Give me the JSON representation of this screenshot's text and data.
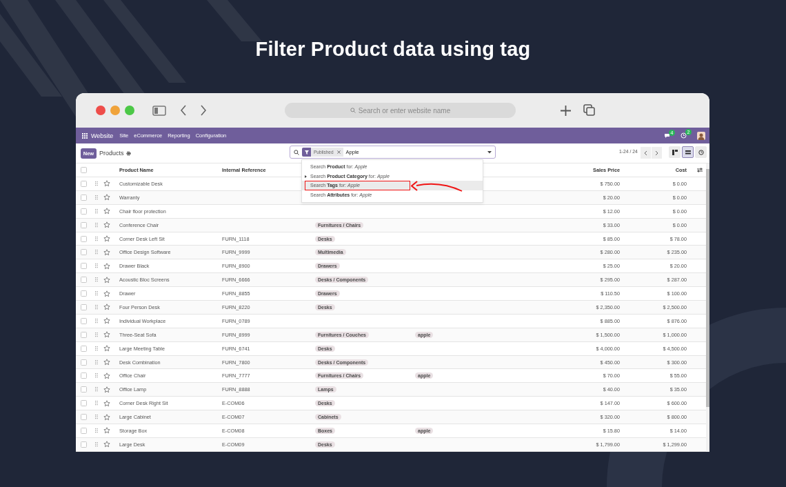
{
  "page_title": "Filter Product data using tag",
  "browser": {
    "address_placeholder": "Search or enter website name"
  },
  "navbar": {
    "app": "Website",
    "menu": [
      "Site",
      "eCommerce",
      "Reporting",
      "Configuration"
    ],
    "badges": [
      "4",
      "2"
    ]
  },
  "control_panel": {
    "new_button": "New",
    "breadcrumb": "Products",
    "search": {
      "facet": "Published",
      "query": "Apple"
    },
    "pager": "1-24 / 24",
    "views": [
      {
        "kind": "kanban",
        "selected": false
      },
      {
        "kind": "list",
        "selected": true
      },
      {
        "kind": "activity",
        "selected": false
      }
    ]
  },
  "suggestions": [
    {
      "text": "Search **Product** for: *Apple*",
      "expandable": false,
      "highlighted": false
    },
    {
      "text": "Search **Product Category** for: *Apple*",
      "expandable": true,
      "highlighted": false
    },
    {
      "text": "Search **Tags** for: *Apple*",
      "expandable": false,
      "highlighted": true
    },
    {
      "text": "Search **Attributes** for: *Apple*",
      "expandable": false,
      "highlighted": false
    }
  ],
  "table": {
    "all_checked": false,
    "columns": [
      "Product Name",
      "Internal Reference",
      "Sales Price",
      "Cost"
    ],
    "rows": [
      {
        "name": "Customizable Desk",
        "price": "$ 750.00",
        "cost": "$ 0.00",
        "checked": false,
        "favorite": false
      },
      {
        "name": "Warranty",
        "price": "$ 20.00",
        "cost": "$ 0.00",
        "checked": false,
        "favorite": false
      },
      {
        "name": "Chair floor protection",
        "price": "$ 12.00",
        "cost": "$ 0.00",
        "checked": false,
        "favorite": false
      },
      {
        "name": "Conference Chair",
        "category": "Furnitures / Chairs",
        "price": "$ 33.00",
        "cost": "$ 0.00",
        "checked": false,
        "favorite": false
      },
      {
        "name": "Corner Desk Left Sit",
        "reference": "FURN_1118",
        "category": "Desks",
        "price": "$ 85.00",
        "cost": "$ 78.00",
        "checked": false,
        "favorite": false
      },
      {
        "name": "Office Design Software",
        "reference": "FURN_9999",
        "category": "Multimedia",
        "price": "$ 280.00",
        "cost": "$ 235.00",
        "checked": false,
        "favorite": false
      },
      {
        "name": "Drawer Black",
        "reference": "FURN_8900",
        "category": "Drawers",
        "price": "$ 25.00",
        "cost": "$ 20.00",
        "checked": false,
        "favorite": false
      },
      {
        "name": "Acoustic Bloc Screens",
        "reference": "FURN_6666",
        "category": "Desks / Components",
        "price": "$ 295.00",
        "cost": "$ 287.00",
        "checked": false,
        "favorite": false
      },
      {
        "name": "Drawer",
        "reference": "FURN_8855",
        "category": "Drawers",
        "price": "$ 110.50",
        "cost": "$ 100.00",
        "checked": false,
        "favorite": false
      },
      {
        "name": "Four Person Desk",
        "reference": "FURN_8220",
        "category": "Desks",
        "price": "$ 2,350.00",
        "cost": "$ 2,500.00",
        "checked": false,
        "favorite": false
      },
      {
        "name": "Individual Workplace",
        "reference": "FURN_0789",
        "price": "$ 885.00",
        "cost": "$ 876.00",
        "checked": false,
        "favorite": false
      },
      {
        "name": "Three-Seat Sofa",
        "reference": "FURN_8999",
        "category": "Furnitures / Couches",
        "tag": "apple",
        "price": "$ 1,500.00",
        "cost": "$ 1,000.00",
        "checked": false,
        "favorite": false
      },
      {
        "name": "Large Meeting Table",
        "reference": "FURN_6741",
        "category": "Desks",
        "price": "$ 4,000.00",
        "cost": "$ 4,500.00",
        "checked": false,
        "favorite": false
      },
      {
        "name": "Desk Combination",
        "reference": "FURN_7800",
        "category": "Desks / Components",
        "price": "$ 450.00",
        "cost": "$ 300.00",
        "checked": false,
        "favorite": false
      },
      {
        "name": "Office Chair",
        "reference": "FURN_7777",
        "category": "Furnitures / Chairs",
        "tag": "apple",
        "price": "$ 70.00",
        "cost": "$ 55.00",
        "checked": false,
        "favorite": false
      },
      {
        "name": "Office Lamp",
        "reference": "FURN_8888",
        "category": "Lamps",
        "price": "$ 40.00",
        "cost": "$ 35.00",
        "checked": false,
        "favorite": false
      },
      {
        "name": "Corner Desk Right Sit",
        "reference": "E-COM06",
        "category": "Desks",
        "price": "$ 147.00",
        "cost": "$ 600.00",
        "checked": false,
        "favorite": false
      },
      {
        "name": "Large Cabinet",
        "reference": "E-COM07",
        "category": "Cabinets",
        "price": "$ 320.00",
        "cost": "$ 800.00",
        "checked": false,
        "favorite": false
      },
      {
        "name": "Storage Box",
        "reference": "E-COM08",
        "category": "Boxes",
        "tag": "apple",
        "price": "$ 15.80",
        "cost": "$ 14.00",
        "checked": false,
        "favorite": false
      },
      {
        "name": "Large Desk",
        "reference": "E-COM09",
        "category": "Desks",
        "price": "$ 1,799.00",
        "cost": "$ 1,299.00",
        "checked": false,
        "favorite": false
      }
    ]
  }
}
